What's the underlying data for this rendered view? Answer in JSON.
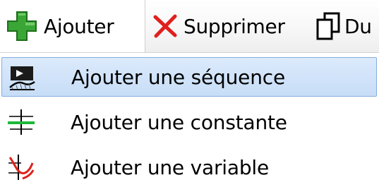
{
  "toolbar": {
    "add_label": "Ajouter",
    "delete_label": "Supprimer",
    "duplicate_label": "Du"
  },
  "menu": {
    "items": [
      {
        "label": "Ajouter une séquence",
        "icon": "sequence-icon",
        "highlighted": true
      },
      {
        "label": "Ajouter une constante",
        "icon": "constant-icon",
        "highlighted": false
      },
      {
        "label": "Ajouter une variable",
        "icon": "variable-icon",
        "highlighted": false
      }
    ]
  },
  "colors": {
    "add_icon": "#3aa635",
    "delete_icon": "#e0201c",
    "highlight_bg": "#c7ddf7",
    "highlight_border": "#84acdd"
  }
}
